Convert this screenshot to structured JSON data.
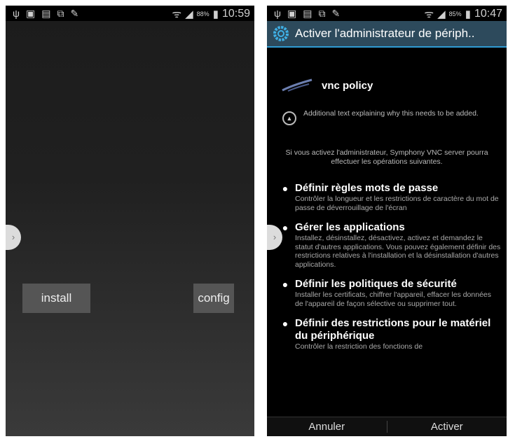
{
  "left_screen": {
    "status_bar": {
      "time": "10:59",
      "battery": "88%"
    },
    "buttons": {
      "install": "install",
      "config": "config"
    },
    "side_handle": "›"
  },
  "right_screen": {
    "status_bar": {
      "time": "10:47",
      "battery": "85%"
    },
    "title": "Activer l'administrateur de périph..",
    "app_name": "vnc policy",
    "note": "Additional text explaining why this needs to be added.",
    "intro": "Si vous activez l'administrateur, Symphony VNC server pourra effectuer les opérations suivantes.",
    "permissions": [
      {
        "title": "Définir règles mots de passe",
        "desc": "Contrôler la longueur et les restrictions de caractère du mot de passe de déverrouillage de l'écran"
      },
      {
        "title": "Gérer les applications",
        "desc": "Installez, désinstallez, désactivez, activez et demandez le statut d'autres applications. Vous pouvez également définir des restrictions relatives à l'installation et la désinstallation d'autres applications."
      },
      {
        "title": "Définir les politiques de sécurité",
        "desc": "Installer les certificats, chiffrer l'appareil, effacer les données de l'appareil de façon sélective ou supprimer tout."
      },
      {
        "title": "Définir des restrictions pour le matériel du périphérique",
        "desc": "Contrôler la restriction des fonctions de"
      }
    ],
    "buttons": {
      "cancel": "Annuler",
      "activate": "Activer"
    },
    "side_handle": "›",
    "colors": {
      "title_bar": "#2d4a5c",
      "accent": "#2f9bd3"
    }
  }
}
